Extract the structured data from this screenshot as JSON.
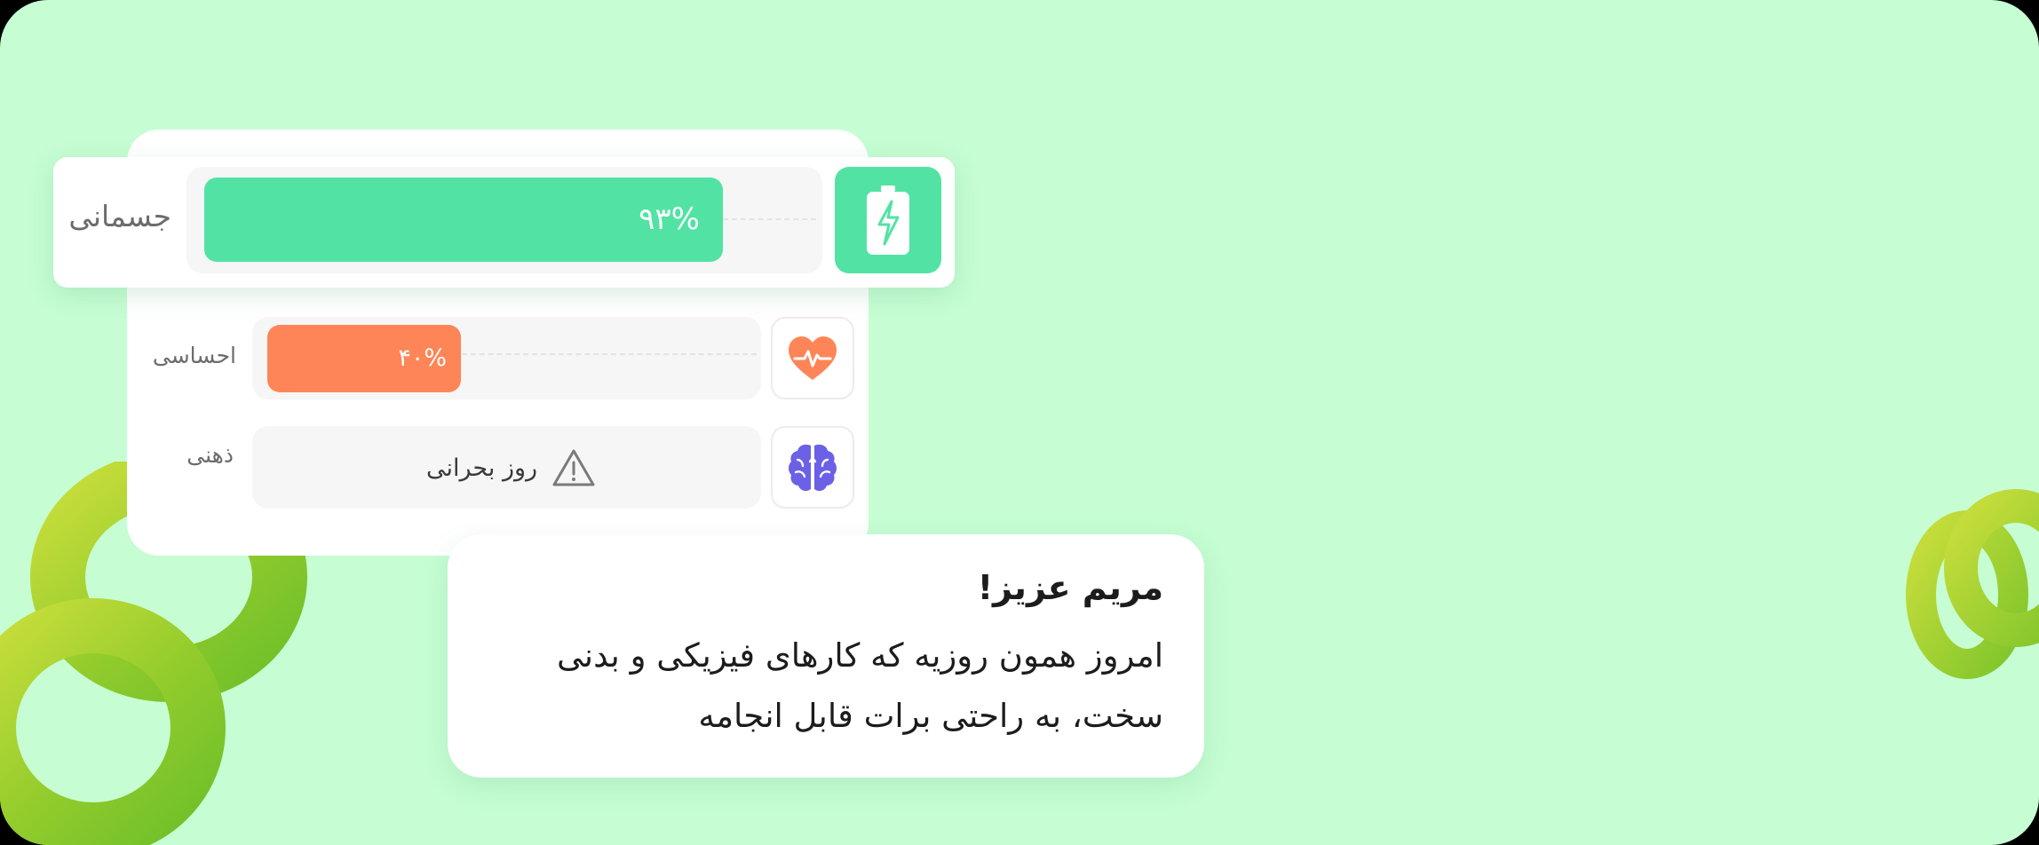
{
  "colors": {
    "background": "#c6fdd3",
    "physical": "#52e3a4",
    "emotional": "#fe8557",
    "mental": "#6b60e6",
    "deco_green": "#9ed42f"
  },
  "energy": {
    "physical": {
      "label": "جسمانی",
      "value_text": "۹۳%",
      "fraction": 0.93,
      "icon": "battery-bolt-icon"
    },
    "emotional": {
      "label": "احساسی",
      "value_text": "۴۰%",
      "fraction": 0.4,
      "icon": "heart-pulse-icon"
    },
    "mental": {
      "label": "ذهنی",
      "status_text": "روز بحرانی",
      "status_icon": "warning-icon",
      "icon": "brain-icon"
    }
  },
  "message": {
    "title": "مریم عزیز!",
    "line1": "امروز همون روزیه که کارهای فیزیکی و بدنی",
    "line2": "سخت، به راحتی برات قابل انجامه"
  }
}
